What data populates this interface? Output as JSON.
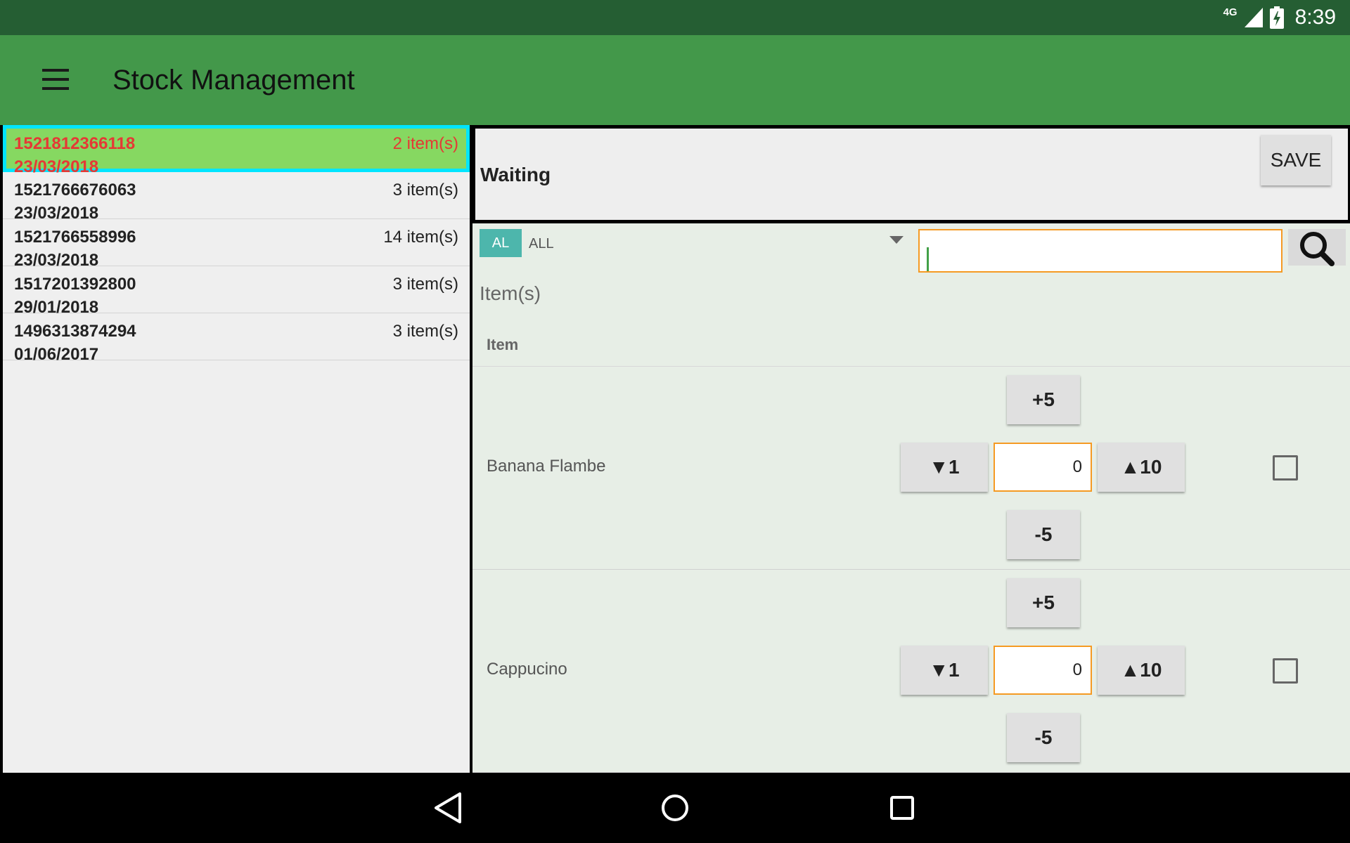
{
  "status_bar": {
    "network": "4G",
    "time": "8:39",
    "icons": [
      "signal-icon",
      "battery-charging-icon"
    ]
  },
  "app_bar": {
    "title": "Stock Management",
    "menu_icon": "hamburger-menu-icon"
  },
  "orders": [
    {
      "id": "1521812366118",
      "date": "23/03/2018",
      "count": "2 item(s)",
      "selected": true
    },
    {
      "id": "1521766676063",
      "date": "23/03/2018",
      "count": "3 item(s)",
      "selected": false
    },
    {
      "id": "1521766558996",
      "date": "23/03/2018",
      "count": "14 item(s)",
      "selected": false
    },
    {
      "id": "1517201392800",
      "date": "29/01/2018",
      "count": "3 item(s)",
      "selected": false
    },
    {
      "id": "1496313874294",
      "date": "01/06/2017",
      "count": "3 item(s)",
      "selected": false
    }
  ],
  "detail": {
    "status": "Waiting",
    "save_label": "SAVE"
  },
  "filter": {
    "badge": "AL",
    "selected": "ALL",
    "search_value": "",
    "search_icon": "magnifier-icon"
  },
  "items_section": {
    "heading": "Item(s)",
    "column_item": "Item"
  },
  "items": [
    {
      "name": "Banana Flambe",
      "quantity": "0",
      "plus5": "+5",
      "down1": "▼1",
      "up10": "▲10",
      "minus5": "-5",
      "checked": false
    },
    {
      "name": "Cappucino",
      "quantity": "0",
      "plus5": "+5",
      "down1": "▼1",
      "up10": "▲10",
      "minus5": "-5",
      "checked": false
    }
  ],
  "colors": {
    "status_bar": "#255E33",
    "app_bar": "#43984A",
    "selected_row": "#86D861",
    "selected_border": "#00E5FF",
    "selected_text": "#E53935",
    "input_border": "#F59A23",
    "badge": "#4DB6AC"
  },
  "nav_bar": {
    "icons": [
      "back-icon",
      "home-icon",
      "recents-icon"
    ]
  }
}
